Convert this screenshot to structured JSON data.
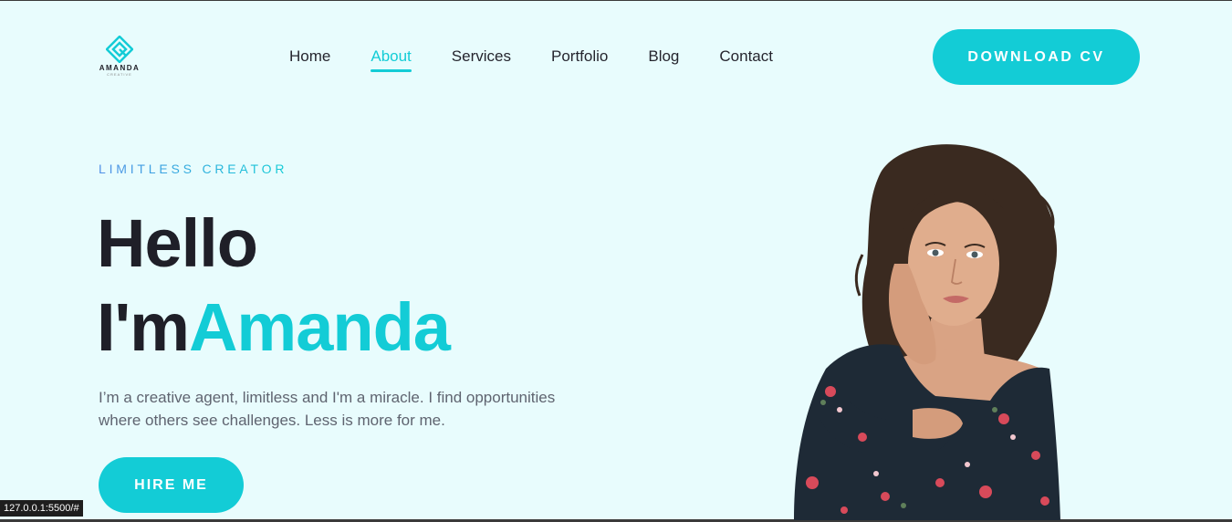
{
  "brand": {
    "name": "AMANDA",
    "tagline": "CREATIVE",
    "accent_color": "#13ccd6",
    "icon": "diamond-logo-icon"
  },
  "nav": {
    "items": [
      {
        "label": "Home",
        "active": false
      },
      {
        "label": "About",
        "active": true
      },
      {
        "label": "Services",
        "active": false
      },
      {
        "label": "Portfolio",
        "active": false
      },
      {
        "label": "Blog",
        "active": false
      },
      {
        "label": "Contact",
        "active": false
      }
    ],
    "cta_label": "DOWNLOAD CV"
  },
  "hero": {
    "eyebrow": "LIMITLESS CREATOR",
    "greeting": "Hello",
    "intro": "I'm",
    "name": "Amanda",
    "description": "I’m a creative agent, limitless and I'm a miracle. I find opportunities where others see challenges. Less is more for me.",
    "cta_label": "HIRE ME",
    "portrait_icon": "portrait-photo"
  },
  "status_bar": {
    "url": "127.0.0.1:5500/#"
  },
  "colors": {
    "background": "#e8fcfd",
    "heading": "#1f1f28",
    "accent": "#13ccd6"
  }
}
